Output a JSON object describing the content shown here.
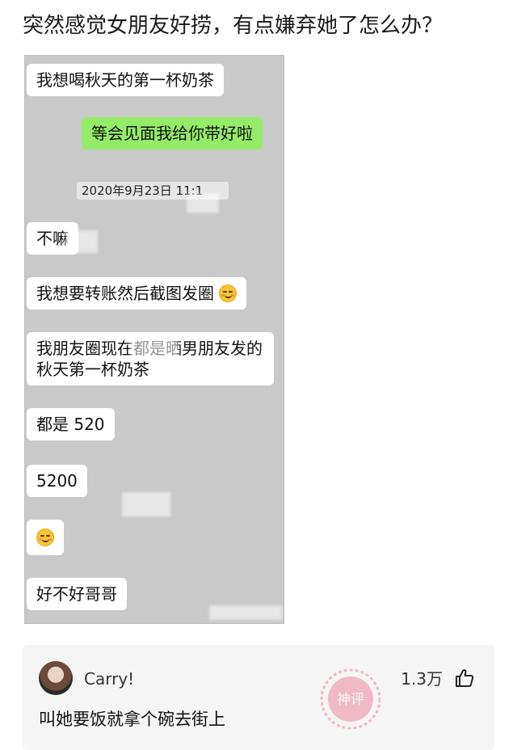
{
  "post": {
    "title": "突然感觉女朋友好捞，有点嫌弃她了怎么办？"
  },
  "chat": {
    "messages": [
      {
        "text": "我想喝秋天的第一杯奶茶"
      },
      {
        "text": "等会见面我给你带好啦"
      },
      {
        "text": "不嘛"
      },
      {
        "text": "我想要转账然后截图发圈",
        "emoji": "blushing-smile-emoji"
      },
      {
        "text": "我朋友圈现在都是晒男朋友发的秋天第一杯奶茶"
      },
      {
        "text": "都是 520"
      },
      {
        "text": "5200"
      },
      {
        "emoji": "blushing-smile-emoji"
      },
      {
        "text": "好不好哥哥"
      }
    ],
    "timestamp": "2020年9月23日 11:1"
  },
  "comment": {
    "username": "Carry!",
    "likes": "1.3万",
    "text": "叫她要饭就拿个碗去街上",
    "badge": "神评",
    "like_icon": "thumbs-up-icon"
  },
  "colors": {
    "chat_background": "#c9c9c9",
    "sent_bubble": "#95ec69",
    "received_bubble": "#ffffff",
    "comment_card": "#f5f5f5",
    "badge": "#e8506a"
  }
}
